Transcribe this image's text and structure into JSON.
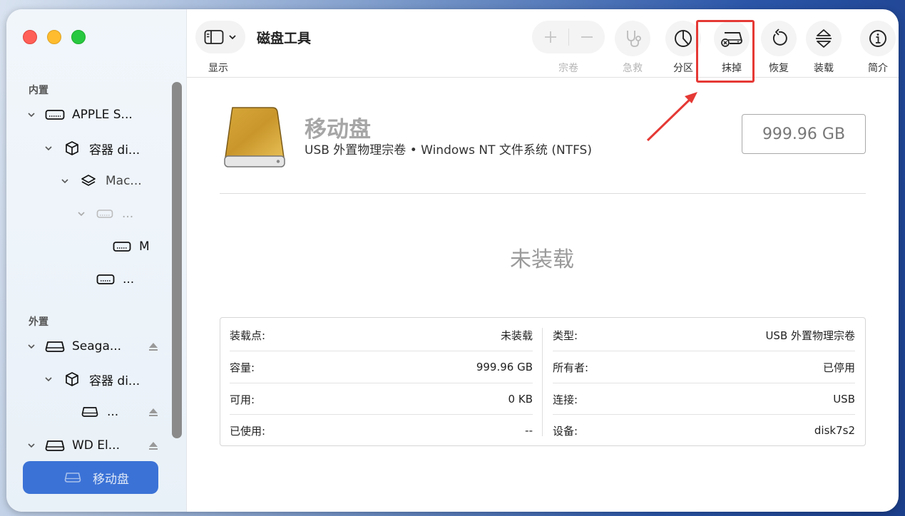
{
  "window": {
    "title": "磁盘工具",
    "view_label": "显示"
  },
  "sidebar": {
    "internal_label": "内置",
    "external_label": "外置",
    "items": [
      {
        "label": "APPLE S...",
        "icon": "internal-drive-icon"
      },
      {
        "label": "容器 di...",
        "icon": "container-box-icon"
      },
      {
        "label": "Mac...",
        "icon": "volume-stack-icon"
      },
      {
        "label": "...",
        "icon": "drive-dim-icon"
      },
      {
        "label": "M",
        "icon": "internal-drive-icon"
      },
      {
        "label": "...",
        "icon": "internal-drive-icon"
      },
      {
        "label": "Seaga...",
        "icon": "external-drive-icon"
      },
      {
        "label": "容器 di...",
        "icon": "container-box-icon"
      },
      {
        "label": "...",
        "icon": "external-drive-icon"
      },
      {
        "label": "WD El...",
        "icon": "external-drive-icon"
      },
      {
        "label": "移动盘",
        "icon": "external-drive-icon"
      }
    ]
  },
  "toolbar": {
    "volume_label": "宗卷",
    "rescue_label": "急救",
    "partition_label": "分区",
    "erase_label": "抹掉",
    "restore_label": "恢复",
    "mount_label": "装载",
    "info_label": "简介"
  },
  "disk": {
    "name": "移动盘",
    "subtitle": "USB 外置物理宗卷 • Windows NT 文件系统 (NTFS)",
    "capacity": "999.96 GB",
    "status": "未装载"
  },
  "info": {
    "left": [
      {
        "key": "装载点:",
        "value": "未装载"
      },
      {
        "key": "容量:",
        "value": "999.96 GB"
      },
      {
        "key": "可用:",
        "value": "0 KB"
      },
      {
        "key": "已使用:",
        "value": "--"
      }
    ],
    "right": [
      {
        "key": "类型:",
        "value": "USB 外置物理宗卷"
      },
      {
        "key": "所有者:",
        "value": "已停用"
      },
      {
        "key": "连接:",
        "value": "USB"
      },
      {
        "key": "设备:",
        "value": "disk7s2"
      }
    ]
  },
  "colors": {
    "accent": "#3b72d6",
    "highlight": "#e53935",
    "disk_gold": "#c9962b"
  }
}
